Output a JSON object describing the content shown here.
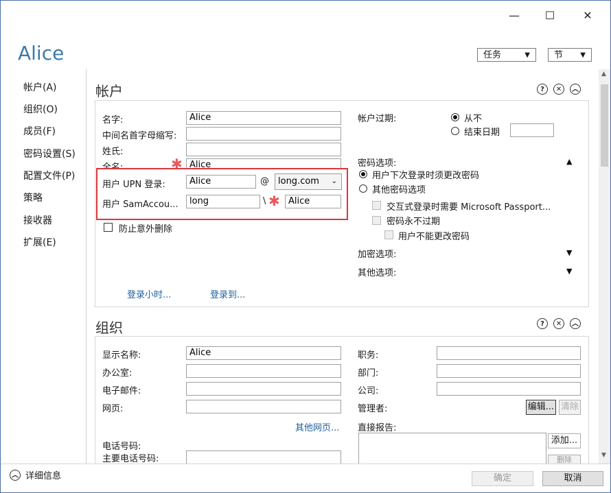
{
  "window": {
    "title": "Alice",
    "controls": {
      "minimize": "—",
      "maximize": "☐",
      "close": "✕"
    }
  },
  "toolbar": {
    "tasks_label": "任务",
    "sections_label": "节"
  },
  "nav": {
    "items": [
      {
        "label": "帐户(A)"
      },
      {
        "label": "组织(O)"
      },
      {
        "label": "成员(F)"
      },
      {
        "label": "密码设置(S)"
      },
      {
        "label": "配置文件(P)"
      },
      {
        "label": "策略"
      },
      {
        "label": "接收器"
      },
      {
        "label": "扩展(E)"
      }
    ]
  },
  "account": {
    "title": "帐户",
    "first_name_label": "名字:",
    "first_name_value": "Alice",
    "middle_initial_label": "中间名首字母缩写:",
    "middle_initial_value": "",
    "last_name_label": "姓氏:",
    "last_name_value": "",
    "full_name_label": "全名:",
    "full_name_value": "Alice",
    "upn_label": "用户 UPN 登录:",
    "upn_value": "Alice",
    "at_sign": "@",
    "upn_domain": "long.com",
    "sam_label": "用户 SamAccou...",
    "sam_domain": "long",
    "backslash": "\\",
    "sam_value": "Alice",
    "protect_label": "防止意外删除",
    "logon_hours_link": "登录小时...",
    "logon_to_link": "登录到...",
    "expires_label": "帐户过期:",
    "never_label": "从不",
    "end_date_label": "结束日期",
    "end_date_value": "",
    "password_options_label": "密码选项:",
    "must_change_label": "用户下次登录时须更改密码",
    "other_options_label": "其他密码选项",
    "passport_label": "交互式登录时需要 Microsoft Passport...",
    "never_expires_label": "密码永不过期",
    "cannot_change_label": "用户不能更改密码",
    "encryption_label": "加密选项:",
    "other_label": "其他选项:"
  },
  "organization": {
    "title": "组织",
    "display_name_label": "显示名称:",
    "display_name_value": "Alice",
    "office_label": "办公室:",
    "office_value": "",
    "email_label": "电子邮件:",
    "email_value": "",
    "webpage_label": "网页:",
    "webpage_value": "",
    "other_pages_link": "其他网页...",
    "phone_label": "电话号码:",
    "main_phone_label": "主要电话号码:",
    "main_phone_value": "",
    "job_title_label": "职务:",
    "job_title_value": "",
    "department_label": "部门:",
    "department_value": "",
    "company_label": "公司:",
    "company_value": "",
    "manager_label": "管理者:",
    "edit_button": "编辑...",
    "clear_button": "清除",
    "direct_reports_label": "直接报告:",
    "add_button": "添加...",
    "remove_button": "删除"
  },
  "footer": {
    "details_label": "详细信息",
    "ok_button": "确定",
    "cancel_button": "取消"
  },
  "colors": {
    "accent": "#3c7aa8",
    "link": "#1f5fa0",
    "highlight": "#d9363e",
    "required": "#e85a5a"
  }
}
